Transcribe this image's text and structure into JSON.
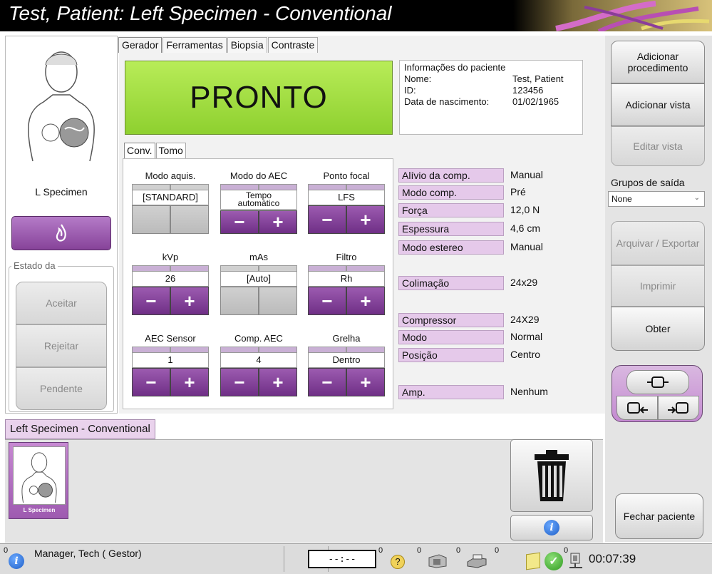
{
  "window": {
    "title": "Test, Patient: Left Specimen - Conventional"
  },
  "left": {
    "view_label": "L Specimen",
    "status_group_label": "Estado da",
    "buttons": {
      "accept": "Aceitar",
      "reject": "Rejeitar",
      "pending": "Pendente"
    }
  },
  "tabs": [
    "Gerador",
    "Ferramentas",
    "Biopsia",
    "Contraste"
  ],
  "ready_text": "PRONTO",
  "patient": {
    "heading": "Informações do paciente",
    "name_label": "Nome:",
    "name": "Test, Patient",
    "id_label": "ID:",
    "id": "123456",
    "dob_label": "Data de nascimento:",
    "dob": "01/02/1965"
  },
  "subtabs": [
    "Conv.",
    "Tomo"
  ],
  "controls": {
    "acq_mode": {
      "label": "Modo aquis.",
      "value": "[STANDARD]"
    },
    "aec_mode": {
      "label": "Modo do AEC",
      "value_line1": "Tempo",
      "value_line2": "automático"
    },
    "focal": {
      "label": "Ponto focal",
      "value": "LFS"
    },
    "kvp": {
      "label": "kVp",
      "value": "26"
    },
    "mas": {
      "label": "mAs",
      "value": "[Auto]"
    },
    "filter": {
      "label": "Filtro",
      "value": "Rh"
    },
    "aec_sensor": {
      "label": "AEC Sensor",
      "value": "1"
    },
    "aec_comp": {
      "label": "Comp. AEC",
      "value": "4"
    },
    "grid": {
      "label": "Grelha",
      "value": "Dentro"
    },
    "minus": "−",
    "plus": "+"
  },
  "params": [
    {
      "k": "Alívio da comp.",
      "v": "Manual"
    },
    {
      "k": "Modo comp.",
      "v": "Pré"
    },
    {
      "k": "Força",
      "v": "12,0 N"
    },
    {
      "k": "Espessura",
      "v": "4,6 cm"
    },
    {
      "k": "Modo estereo",
      "v": "Manual"
    },
    {
      "k": "Colimação",
      "v": "24x29"
    },
    {
      "k": "Compressor",
      "v": "24X29"
    },
    {
      "k": "Modo",
      "v": "Normal"
    },
    {
      "k": "Posição",
      "v": "Centro"
    },
    {
      "k": "Amp.",
      "v": "Nenhum"
    }
  ],
  "right": {
    "add_procedure": "Adicionar procedimento",
    "add_view": "Adicionar vista",
    "edit_view": "Editar vista",
    "output_groups_label": "Grupos de saída",
    "output_group_value": "None",
    "archive_export": "Arquivar / Exportar",
    "print": "Imprimir",
    "get": "Obter",
    "close_patient": "Fechar paciente"
  },
  "series": {
    "tab_label": "Left Specimen - Conventional",
    "thumb_caption": "L Specimen"
  },
  "status": {
    "left_badge": "0",
    "user": "Manager, Tech ( Gestor)",
    "timer_display": "--:--",
    "badges": [
      "0",
      "0",
      "0",
      "0",
      "0"
    ],
    "clock": "00:07:39"
  },
  "colors": {
    "ready": "#a6e04a",
    "accent_purple": "#8a47a0",
    "param_label": "#e5c9ea"
  }
}
